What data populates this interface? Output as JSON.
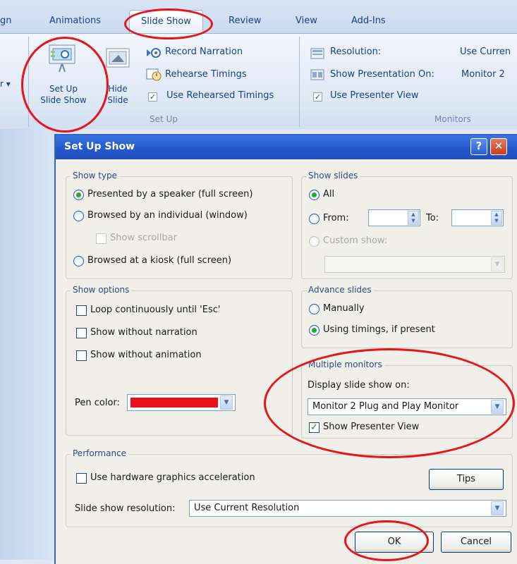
{
  "ribbon": {
    "tabs": [
      "gn",
      "Animations",
      "Slide Show",
      "Review",
      "View",
      "Add-Ins"
    ],
    "active_tab": "Slide Show",
    "setup_group": {
      "setup_show_label_line1": "Set Up",
      "setup_show_label_line2": "Slide Show",
      "hide_slide_line1": "Hide",
      "hide_slide_line2": "Slide",
      "record_narration": "Record Narration",
      "rehearse_timings": "Rehearse Timings",
      "use_rehearsed_timings": "Use Rehearsed Timings",
      "group_label": "Set Up",
      "use_rehearsed_checked": true
    },
    "monitors_group": {
      "resolution_label": "Resolution:",
      "resolution_value": "Use Curren",
      "show_on_label": "Show Presentation On:",
      "show_on_value": "Monitor 2",
      "use_presenter_view": "Use Presenter View",
      "use_presenter_checked": true,
      "group_label": "Monitors"
    },
    "left_dropdown_glyph": "r ▾"
  },
  "dialog": {
    "title": "Set Up Show",
    "help_glyph": "?",
    "close_glyph": "✕",
    "show_type": {
      "legend": "Show type",
      "option_speaker": "Presented by a speaker (full screen)",
      "option_individual": "Browsed by an individual (window)",
      "show_scrollbar": "Show scrollbar",
      "option_kiosk": "Browsed at a kiosk (full screen)",
      "selected": "speaker"
    },
    "show_slides": {
      "legend": "Show slides",
      "all_label": "All",
      "from_label": "From:",
      "to_label": "To:",
      "custom_show_label": "Custom show:",
      "selected": "all"
    },
    "show_options": {
      "legend": "Show options",
      "loop": "Loop continuously until 'Esc'",
      "without_narration": "Show without narration",
      "without_animation": "Show without animation",
      "pen_color_label": "Pen color:",
      "pen_color": "#e8101b"
    },
    "advance_slides": {
      "legend": "Advance slides",
      "manually": "Manually",
      "using_timings": "Using timings, if present",
      "selected": "using_timings"
    },
    "multiple_monitors": {
      "legend": "Multiple monitors",
      "display_on_label": "Display slide show on:",
      "display_on_value": "Monitor 2 Plug and Play Monitor",
      "show_presenter_view": "Show Presenter View",
      "show_presenter_checked": true
    },
    "performance": {
      "legend": "Performance",
      "hardware_accel": "Use hardware graphics acceleration",
      "tips_button": "Tips",
      "resolution_label": "Slide show resolution:",
      "resolution_value": "Use Current Resolution"
    },
    "ok_button": "OK",
    "cancel_button": "Cancel"
  },
  "colors": {
    "highlight_ring": "#e8141b",
    "title_bar": "#2356c9",
    "ribbon_text": "#15428b"
  }
}
